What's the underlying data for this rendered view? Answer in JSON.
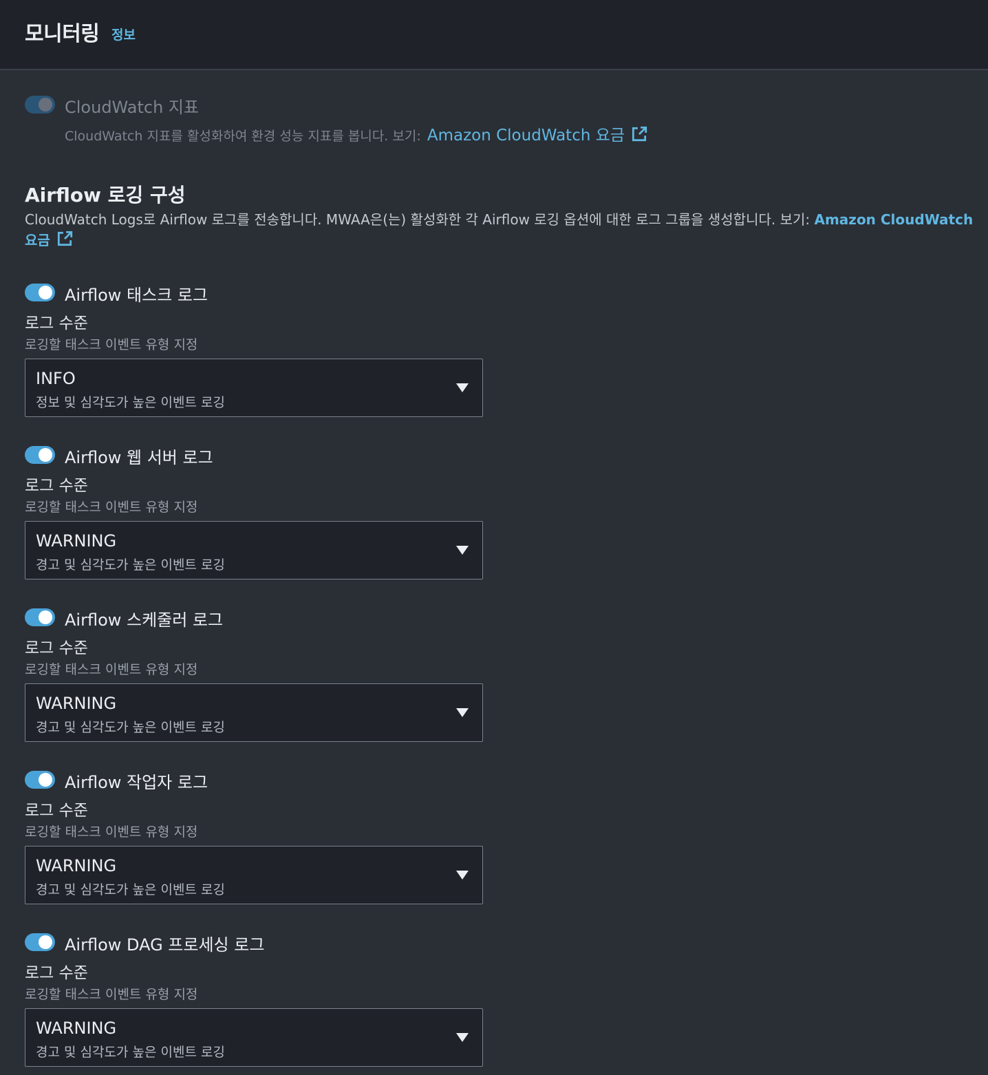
{
  "header": {
    "title": "모니터링",
    "info_link": "정보"
  },
  "cloudwatch_metrics": {
    "label": "CloudWatch 지표",
    "enabled": true,
    "disabled": true,
    "description": "CloudWatch 지표를 활성화하여 환경 성능 지표를 봅니다. 보기:",
    "link_text": "Amazon CloudWatch 요금",
    "link_icon": "external-link-icon"
  },
  "logging": {
    "title": "Airflow 로깅 구성",
    "description": "CloudWatch Logs로 Airflow 로그를 전송합니다. MWAA은(는) 활성화한 각 Airflow 로깅 옵션에 대한 로그 그룹을 생성합니다. 보기:",
    "link_text": "Amazon CloudWatch 요금",
    "link_icon": "external-link-icon",
    "items": [
      {
        "title": "Airflow 태스크 로그",
        "enabled": true,
        "level_label": "로그 수준",
        "level_description": "로깅할 태스크 이벤트 유형 지정",
        "selected_value": "INFO",
        "selected_description": "정보 및 심각도가 높은 이벤트 로깅"
      },
      {
        "title": "Airflow 웹 서버 로그",
        "enabled": true,
        "level_label": "로그 수준",
        "level_description": "로깅할 태스크 이벤트 유형 지정",
        "selected_value": "WARNING",
        "selected_description": "경고 및 심각도가 높은 이벤트 로깅"
      },
      {
        "title": "Airflow 스케줄러 로그",
        "enabled": true,
        "level_label": "로그 수준",
        "level_description": "로깅할 태스크 이벤트 유형 지정",
        "selected_value": "WARNING",
        "selected_description": "경고 및 심각도가 높은 이벤트 로깅"
      },
      {
        "title": "Airflow 작업자 로그",
        "enabled": true,
        "level_label": "로그 수준",
        "level_description": "로깅할 태스크 이벤트 유형 지정",
        "selected_value": "WARNING",
        "selected_description": "경고 및 심각도가 높은 이벤트 로깅"
      },
      {
        "title": "Airflow DAG 프로세싱 로그",
        "enabled": true,
        "level_label": "로그 수준",
        "level_description": "로깅할 태스크 이벤트 유형 지정",
        "selected_value": "WARNING",
        "selected_description": "경고 및 심각도가 높은 이벤트 로깅"
      }
    ]
  },
  "colors": {
    "background": "#2a2e35",
    "header_background": "#1f2229",
    "link": "#5fb7e2",
    "toggle_on": "#4aa3d8",
    "toggle_disabled": "#2b5577"
  }
}
